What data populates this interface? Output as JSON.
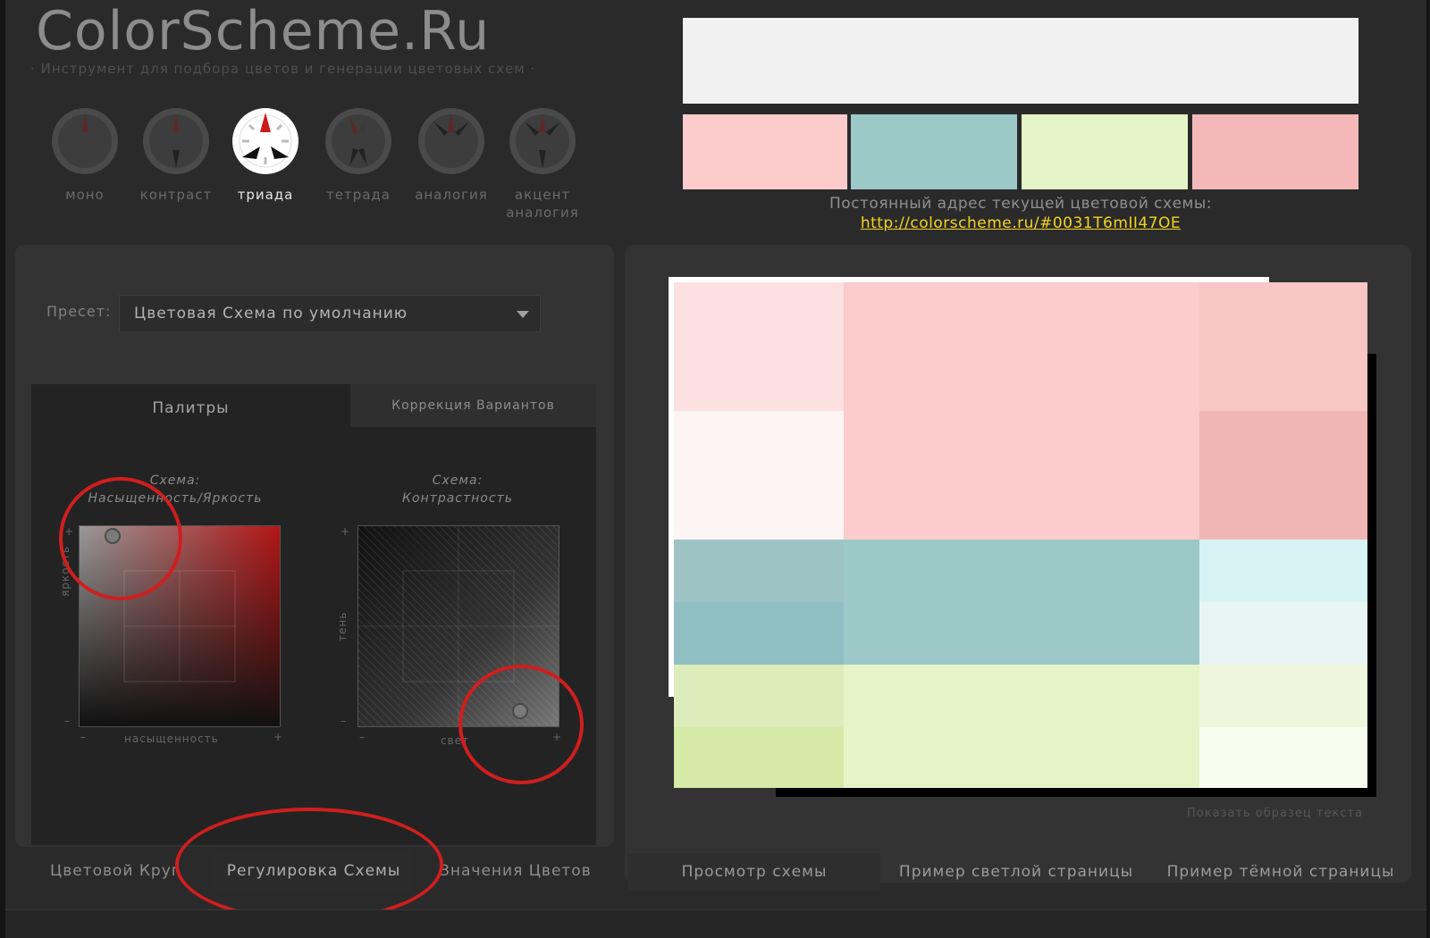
{
  "app": {
    "title": "ColorScheme.Ru",
    "tagline": "· Инструмент для подбора цветов и генерации цветовых схем ·"
  },
  "modes": [
    {
      "label": "моно",
      "icon": "mono-wheel-icon"
    },
    {
      "label": "контраст",
      "icon": "contrast-wheel-icon"
    },
    {
      "label": "триада",
      "icon": "triad-wheel-icon",
      "active": true
    },
    {
      "label": "тетрада",
      "icon": "tetrad-wheel-icon"
    },
    {
      "label": "аналогия",
      "icon": "analogy-wheel-icon"
    },
    {
      "label": "акцент\nаналогия",
      "icon": "accent-analogy-wheel-icon"
    }
  ],
  "swatches": {
    "main": "#f1f1f1",
    "row": [
      "#fccbcb",
      "#9dc8c8",
      "#e4f4c6",
      "#f4b8b8"
    ]
  },
  "permalink": {
    "label": "Постоянный адрес текущей цветовой схемы:",
    "url": "http://colorscheme.ru/#0031T6mII47OE"
  },
  "preset": {
    "label": "Пресет:",
    "value": "Цветовая Схема по умолчанию"
  },
  "subtabs": {
    "palettes": "Палитры",
    "correction": "Коррекция Вариантов"
  },
  "graphs": {
    "saturation": {
      "title1": "Схема:",
      "title2": "Насыщенность/Яркость",
      "xlabel": "насыщенность",
      "ylabel": "яркость",
      "minus": "–",
      "plus": "+"
    },
    "contrast": {
      "title1": "Схема:",
      "title2": "Контрастность",
      "xlabel": "свет",
      "ylabel": "тень",
      "minus": "–",
      "plus": "+"
    }
  },
  "bottom_tabs": [
    "Цветовой Круг",
    "Регулировка Схемы",
    "Значения Цветов"
  ],
  "right_tabs": [
    "Просмотр схемы",
    "Пример светлой страницы",
    "Пример тёмной страницы"
  ],
  "show_sample_text": "Показать образец текста",
  "preview_colors": {
    "pink": [
      "#fde0e0",
      "#fdf4f4",
      "#fccbcb",
      "#f9c6c6",
      "#f0b5b5"
    ],
    "teal": [
      "#9dc3c5",
      "#8fbfc3",
      "#9dc8c8",
      "#d7f3f3",
      "#e9f5f5"
    ],
    "lime": [
      "#dcecba",
      "#d6eaa8",
      "#e4f4c6",
      "#eef7dc",
      "#f7fcee"
    ]
  }
}
